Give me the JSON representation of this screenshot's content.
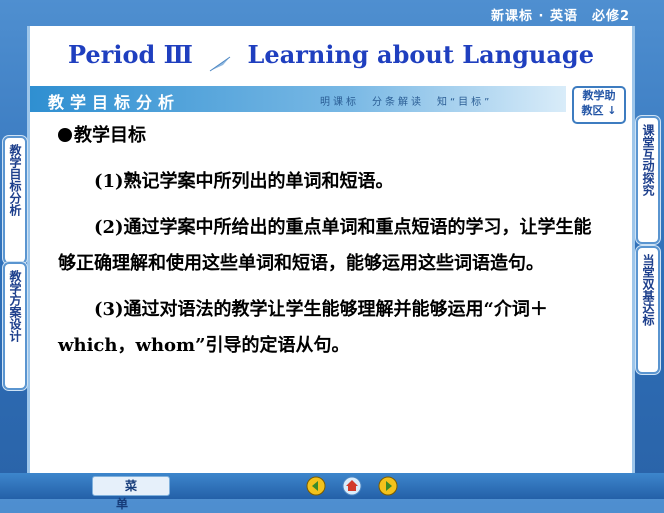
{
  "header": {
    "course": "新课标 · 英语　必修2"
  },
  "slide": {
    "title_left": "Period Ⅲ",
    "title_right": "Learning about Language",
    "banner_left": "教学目标分析",
    "banner_right": "明课标　分条解读　知“目标”",
    "assist_line1": "教学助",
    "assist_line2": "教区 ↓"
  },
  "content": {
    "heading": "教学目标",
    "item1": "(1)熟记学案中所列出的单词和短语。",
    "item2": "(2)通过学案中所给出的重点单词和重点短语的学习，让学生能够正确理解和使用这些单词和短语，能够运用这些词语造句。",
    "item3": "(3)通过对语法的教学让学生能够理解并能够运用“介词＋which，whom”引导的定语从句。"
  },
  "nav": {
    "left_tab1": "教学目标分析",
    "left_tab2": "教学方案设计",
    "right_tab1": "课堂互动探究",
    "right_tab2": "当堂双基达标"
  },
  "footer": {
    "menu_label": "菜单"
  },
  "colors": {
    "accent": "#1f3fbf",
    "frame": "#2e6fb8"
  }
}
